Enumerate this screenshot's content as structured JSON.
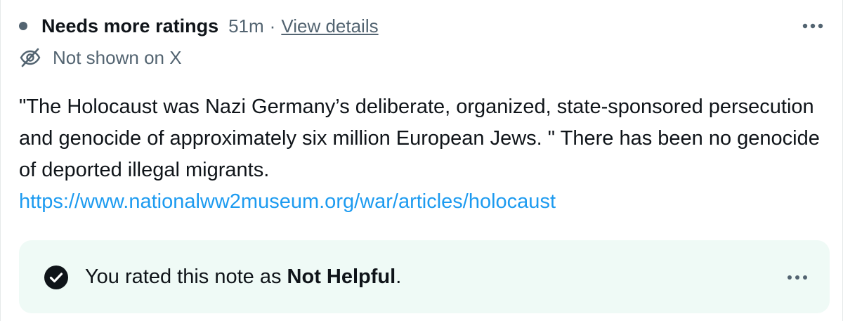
{
  "header": {
    "status_title": "Needs more ratings",
    "time": "51m",
    "separator": "·",
    "view_details": "View details",
    "more_icon": "more-horizontal-icon"
  },
  "visibility": {
    "icon": "eye-off-icon",
    "label": "Not shown on X"
  },
  "note": {
    "text": "\"The Holocaust was Nazi Germany’s deliberate, organized, state-sponsored persecution and genocide of approximately six million European Jews. \" There has been no genocide of deported illegal migrants.",
    "link": "https://www.nationalww2museum.org/war/articles/holocaust"
  },
  "rating": {
    "icon": "check-circle-icon",
    "prefix": "You rated this note as ",
    "value": "Not Helpful",
    "suffix": ".",
    "more_icon": "more-horizontal-icon"
  },
  "colors": {
    "text": "#0f1419",
    "secondary": "#536471",
    "link": "#1d9bf0",
    "rating_bg": "#effaf6"
  }
}
